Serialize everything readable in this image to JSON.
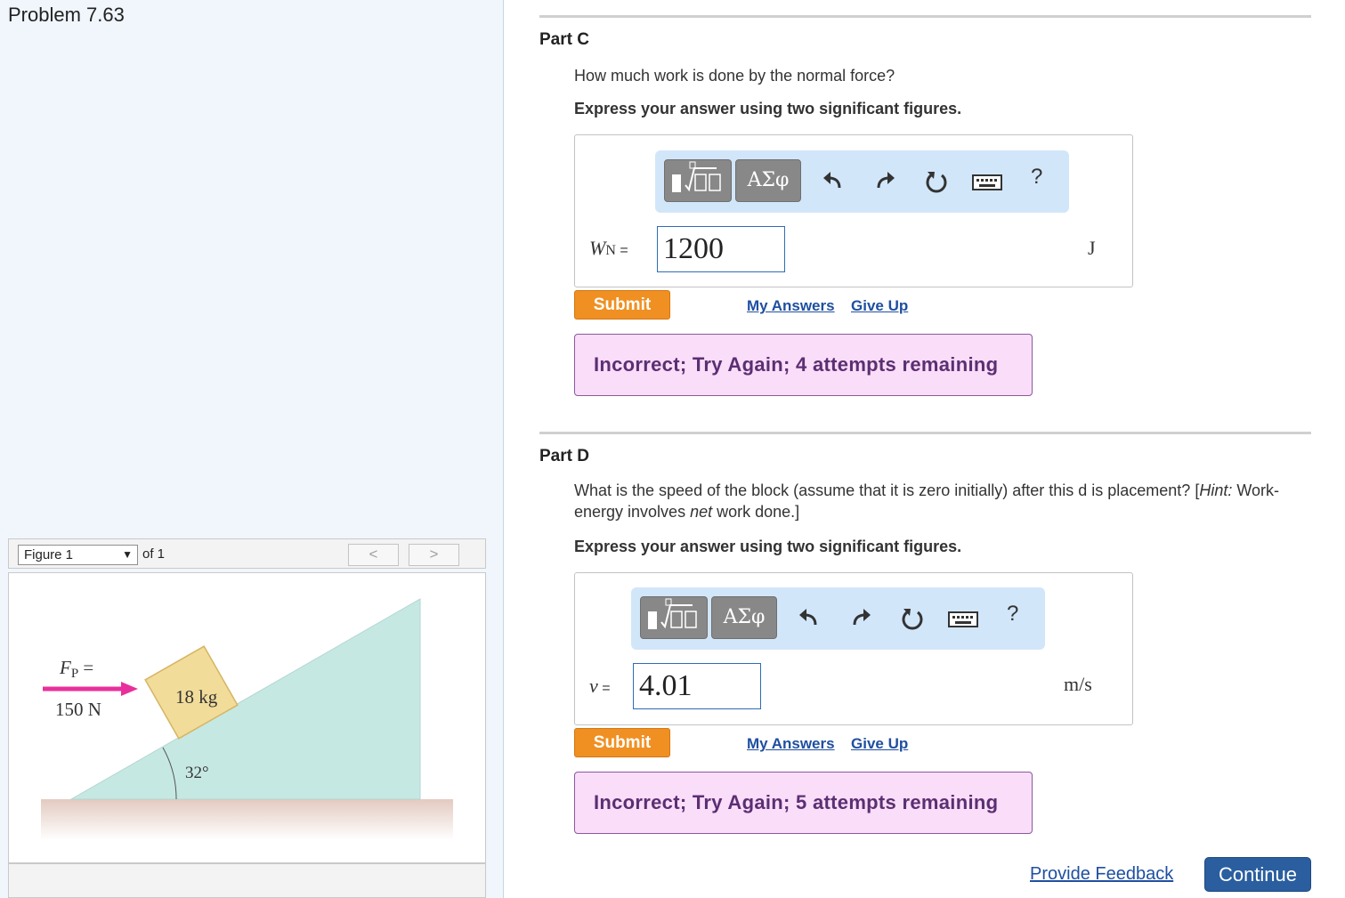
{
  "problem": {
    "title": "Problem 7.63"
  },
  "figure": {
    "selected": "Figure 1",
    "of_label": "of 1",
    "prev": "<",
    "next": ">",
    "force_label_top": "F",
    "force_label_sub": "P",
    "force_label_eq": " =",
    "force_value": "150 N",
    "mass_label": "18 kg",
    "angle_label": "32°",
    "colors": {
      "incline": "#c6e8e3",
      "block": "#f2dc9a",
      "ground": "#e3cac0",
      "arrow": "#e8309c"
    }
  },
  "toolbar": {
    "greek": "ΑΣφ",
    "help": "?"
  },
  "part_c": {
    "title": "Part C",
    "question": "How much work is done by the normal force?",
    "instruction": "Express your answer using two significant figures.",
    "variable": "W",
    "variable_sub": "N",
    "equals": " =",
    "answer_value": "1200",
    "unit": "J",
    "submit": "Submit",
    "my_answers": "My Answers",
    "give_up": "Give Up",
    "feedback": "Incorrect; Try Again; 4 attempts remaining"
  },
  "part_d": {
    "title": "Part D",
    "question_a": "What is the speed of the block (assume that it is zero initially) after this d is placement? [",
    "hint": "Hint:",
    "question_b": " Work-energy involves ",
    "net": "net",
    "question_c": " work done.]",
    "instruction": "Express your answer using two significant figures.",
    "variable": "v",
    "equals": " =",
    "answer_value": "4.01",
    "unit": "m/s",
    "submit": "Submit",
    "my_answers": "My Answers",
    "give_up": "Give Up",
    "feedback": "Incorrect; Try Again; 5 attempts remaining"
  },
  "footer": {
    "provide_feedback": "Provide Feedback",
    "continue": "Continue"
  }
}
